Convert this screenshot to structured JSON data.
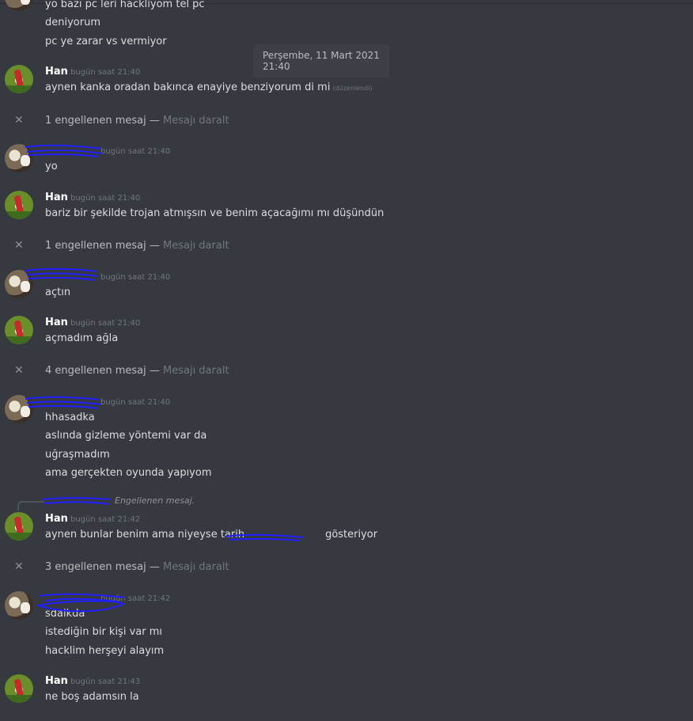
{
  "timestamp_tooltip": {
    "date": "Perşembe, 11 Mart 2021",
    "time": "21:40"
  },
  "messages": [
    {
      "lines": [
        "yo bazı pc leri hackliyom tel pc",
        "deniyorum",
        "pc ye zarar vs vermiyor"
      ]
    },
    {
      "author": "Han",
      "time": "bugün saat 21:40",
      "lines": [
        "aynen kanka oradan bakınca enayiye benziyorum di mi"
      ],
      "edited": "(düzenlendi)"
    },
    {
      "blocked_label": "1 engellenen mesaj — ",
      "collapse_label": "Mesajı daralt"
    },
    {
      "time": "bugün saat 21:40",
      "lines": [
        "yo"
      ]
    },
    {
      "author": "Han",
      "time": "bugün saat 21:40",
      "lines": [
        "bariz bir şekilde trojan atmışsın ve benim açacağımı mı düşündün"
      ]
    },
    {
      "blocked_label": "1 engellenen mesaj — ",
      "collapse_label": "Mesajı daralt"
    },
    {
      "time": "bugün saat 21:40",
      "lines": [
        "açtın"
      ]
    },
    {
      "author": "Han",
      "time": "bugün saat 21:40",
      "lines": [
        "açmadım ağla"
      ]
    },
    {
      "blocked_label": "4 engellenen mesaj — ",
      "collapse_label": "Mesajı daralt"
    },
    {
      "time": "bugün saat 21:40",
      "lines": [
        "hhasadka",
        "aslında gizleme yöntemi var da",
        "uğraşmadım",
        "ama gerçekten oyunda yapıyom"
      ]
    },
    {
      "reply_text": "Engellenen mesaj."
    },
    {
      "author": "Han",
      "time": "bugün saat 21:42",
      "lines": [
        "aynen bunlar benim ama niyeyse tarih",
        "gösteriyor"
      ]
    },
    {
      "blocked_label": "3 engellenen mesaj — ",
      "collapse_label": "Mesajı daralt"
    },
    {
      "time": "bugün saat 21:42",
      "lines": [
        "sdaikda",
        "istediğin bir kişi var mı",
        "hacklim herşeyi alayım"
      ]
    },
    {
      "author": "Han",
      "time": "bugün saat 21:43",
      "lines": [
        "ne boş adamsın la"
      ]
    }
  ],
  "icons": {
    "blocked": "close-x-icon"
  },
  "colors": {
    "background": "#36393f",
    "text": "#dcddde",
    "muted": "#72767d",
    "scribble": "#1f1fff"
  }
}
